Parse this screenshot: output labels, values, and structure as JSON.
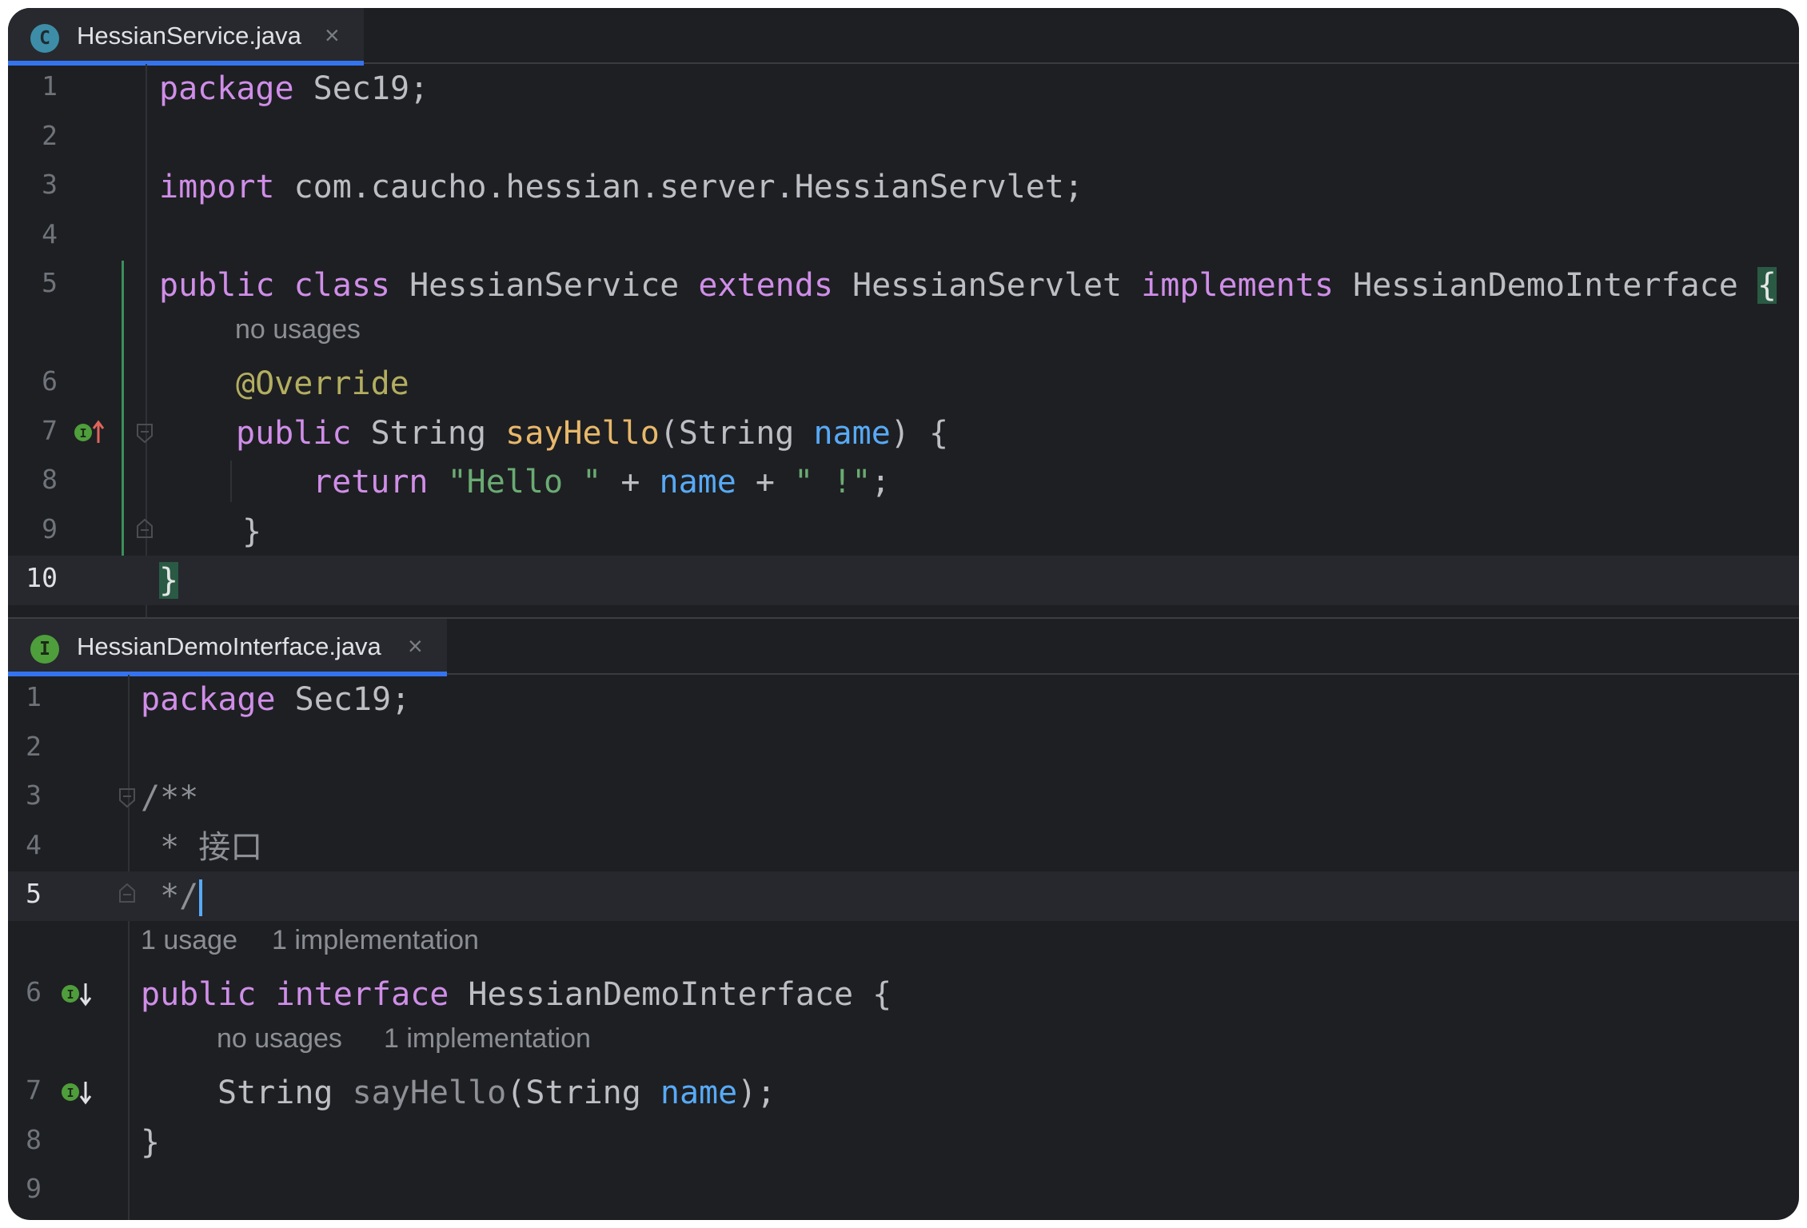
{
  "top_editor": {
    "tab": {
      "title": "HessianService.java",
      "badge": "C",
      "close": "×"
    },
    "lines": {
      "l1": {
        "num": "1"
      },
      "l2": {
        "num": "2"
      },
      "l3": {
        "num": "3"
      },
      "l4": {
        "num": "4"
      },
      "l5": {
        "num": "5"
      },
      "l6": {
        "num": "6"
      },
      "l7": {
        "num": "7"
      },
      "l8": {
        "num": "8"
      },
      "l9": {
        "num": "9"
      },
      "l10": {
        "num": "10"
      }
    },
    "code": {
      "t_package": "package",
      "t_pkgname": " Sec19;",
      "t_import": "import",
      "t_importname": " com.caucho.hessian.server.HessianServlet;",
      "t_public": "public",
      "t_class": "class",
      "t_classname": " HessianService ",
      "t_extends": "extends",
      "t_super": " HessianServlet ",
      "t_implements": "implements",
      "t_iface": " HessianDemoInterface ",
      "t_obrace": "{",
      "t_override": "@Override",
      "t_public2": "public",
      "t_string": " String ",
      "t_sayhello": "sayHello",
      "t_open": "(String ",
      "t_name": "name",
      "t_close": ") {",
      "t_return": "return",
      "t_hello": "\"Hello \"",
      "t_plus1": " + ",
      "t_name2": "name",
      "t_plus2": " + ",
      "t_excl": "\" !\"",
      "t_semi": ";",
      "t_cbrace_inner": "}",
      "t_cbrace_outer": "}"
    },
    "hints": {
      "method_usages": "no usages"
    }
  },
  "bottom_editor": {
    "tab": {
      "title": "HessianDemoInterface.java",
      "badge": "I",
      "close": "×"
    },
    "lines": {
      "l1": {
        "num": "1"
      },
      "l2": {
        "num": "2"
      },
      "l3": {
        "num": "3"
      },
      "l4": {
        "num": "4"
      },
      "l5": {
        "num": "5"
      },
      "l6": {
        "num": "6"
      },
      "l7": {
        "num": "7"
      },
      "l8": {
        "num": "8"
      },
      "l9": {
        "num": "9"
      }
    },
    "code": {
      "t_package": "package",
      "t_pkgname": " Sec19;",
      "t_doc_open": "/**",
      "t_doc_body": " * 接口",
      "t_doc_close": " */",
      "t_public": "public",
      "t_interface": "interface",
      "t_iname": " HessianDemoInterface {",
      "t_string": "String ",
      "t_sayhello": "sayHello",
      "t_open": "(String ",
      "t_name": "name",
      "t_close": ");",
      "t_cbrace": "}"
    },
    "hints": {
      "iface_usages": "1 usage",
      "iface_impls": "1 implementation",
      "method_usages": "no usages",
      "method_impls": "1 implementation"
    }
  },
  "colors": {
    "background": "#1e1f22",
    "keyword": "#cf8ee8",
    "string": "#6aab73",
    "function": "#e8b86a",
    "parameter": "#57aaf7",
    "annotation": "#b3ae60",
    "tab_underline": "#3574f0"
  },
  "icons": {
    "top_tab": "class-file-icon",
    "bottom_tab": "interface-file-icon",
    "top_line7": "implements-method-up-icon",
    "bottom_line6": "implemented-interface-down-icon",
    "bottom_line7": "implemented-method-down-icon"
  }
}
